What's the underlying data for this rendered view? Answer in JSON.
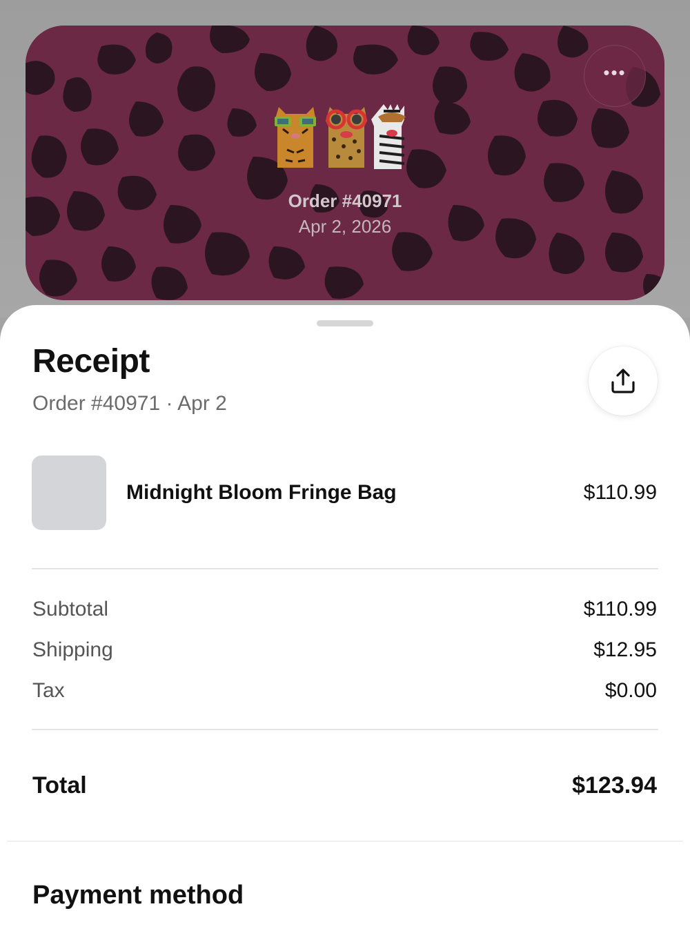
{
  "hero": {
    "order_label": "Order #40971",
    "date_label": "Apr 2, 2026",
    "more_icon": "ellipsis-icon",
    "background_color": "#7a2c4e",
    "spot_color": "#2c1420"
  },
  "receipt": {
    "title": "Receipt",
    "subtitle": "Order #40971 · Apr 2",
    "share_icon": "share-icon",
    "items": [
      {
        "name": "Midnight Bloom Fringe Bag",
        "price": "$110.99"
      }
    ],
    "summary": [
      {
        "label": "Subtotal",
        "value": "$110.99"
      },
      {
        "label": "Shipping",
        "value": "$12.95"
      },
      {
        "label": "Tax",
        "value": "$0.00"
      }
    ],
    "total": {
      "label": "Total",
      "value": "$123.94"
    }
  },
  "payment": {
    "title": "Payment method"
  }
}
